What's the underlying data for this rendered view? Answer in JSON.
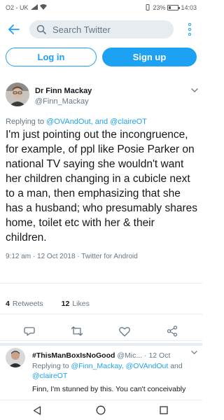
{
  "status_bar": {
    "carrier": "O2 - UK",
    "battery": "23%",
    "time": "14:03"
  },
  "search": {
    "placeholder": "Search Twitter"
  },
  "auth": {
    "login_label": "Log in",
    "signup_label": "Sign up"
  },
  "tweet": {
    "author_name": "Dr Finn Mackay",
    "author_handle": "@Finn_Mackay",
    "replying_prefix": "Replying to",
    "replying_mentions": "@OVAndOut, and @claireOT",
    "text": "I'm just pointing out the incongruence, for example, of ppl like Posie Parker on national TV saying she wouldn't want her children changing in a cubicle next to a man, then emphasizing that she has a husband; who presumably shares home, toilet etc with her & their children.",
    "meta": "9:12 am · 12 Oct 2018 · Twitter for Android",
    "retweets_count": "4",
    "retweets_label": "Retweets",
    "likes_count": "12",
    "likes_label": "Likes"
  },
  "reply": {
    "author_name": "#ThisManBoxIsNoGood",
    "author_handle": "@Mic...",
    "date": "12 Oct",
    "replying_prefix": "Replying to",
    "replying_mentions_1": "@Finn_Mackay, @OVAndOut",
    "replying_and": "and",
    "replying_mentions_2": "@claireOT",
    "text": "Finn, I'm stunned by this. You can't conceivably"
  },
  "colors": {
    "accent": "#1da1f2",
    "secondary_text": "#657786",
    "primary_text": "#14171a",
    "divider": "#e6ecf0"
  },
  "icons": {
    "back": "arrow-left-icon",
    "search": "search-icon",
    "more": "more-vertical-icon",
    "reply": "reply-icon",
    "retweet": "retweet-icon",
    "like": "heart-icon",
    "share": "share-icon",
    "nav_back": "triangle-back-icon",
    "nav_home": "circle-home-icon",
    "nav_recents": "square-recents-icon"
  }
}
